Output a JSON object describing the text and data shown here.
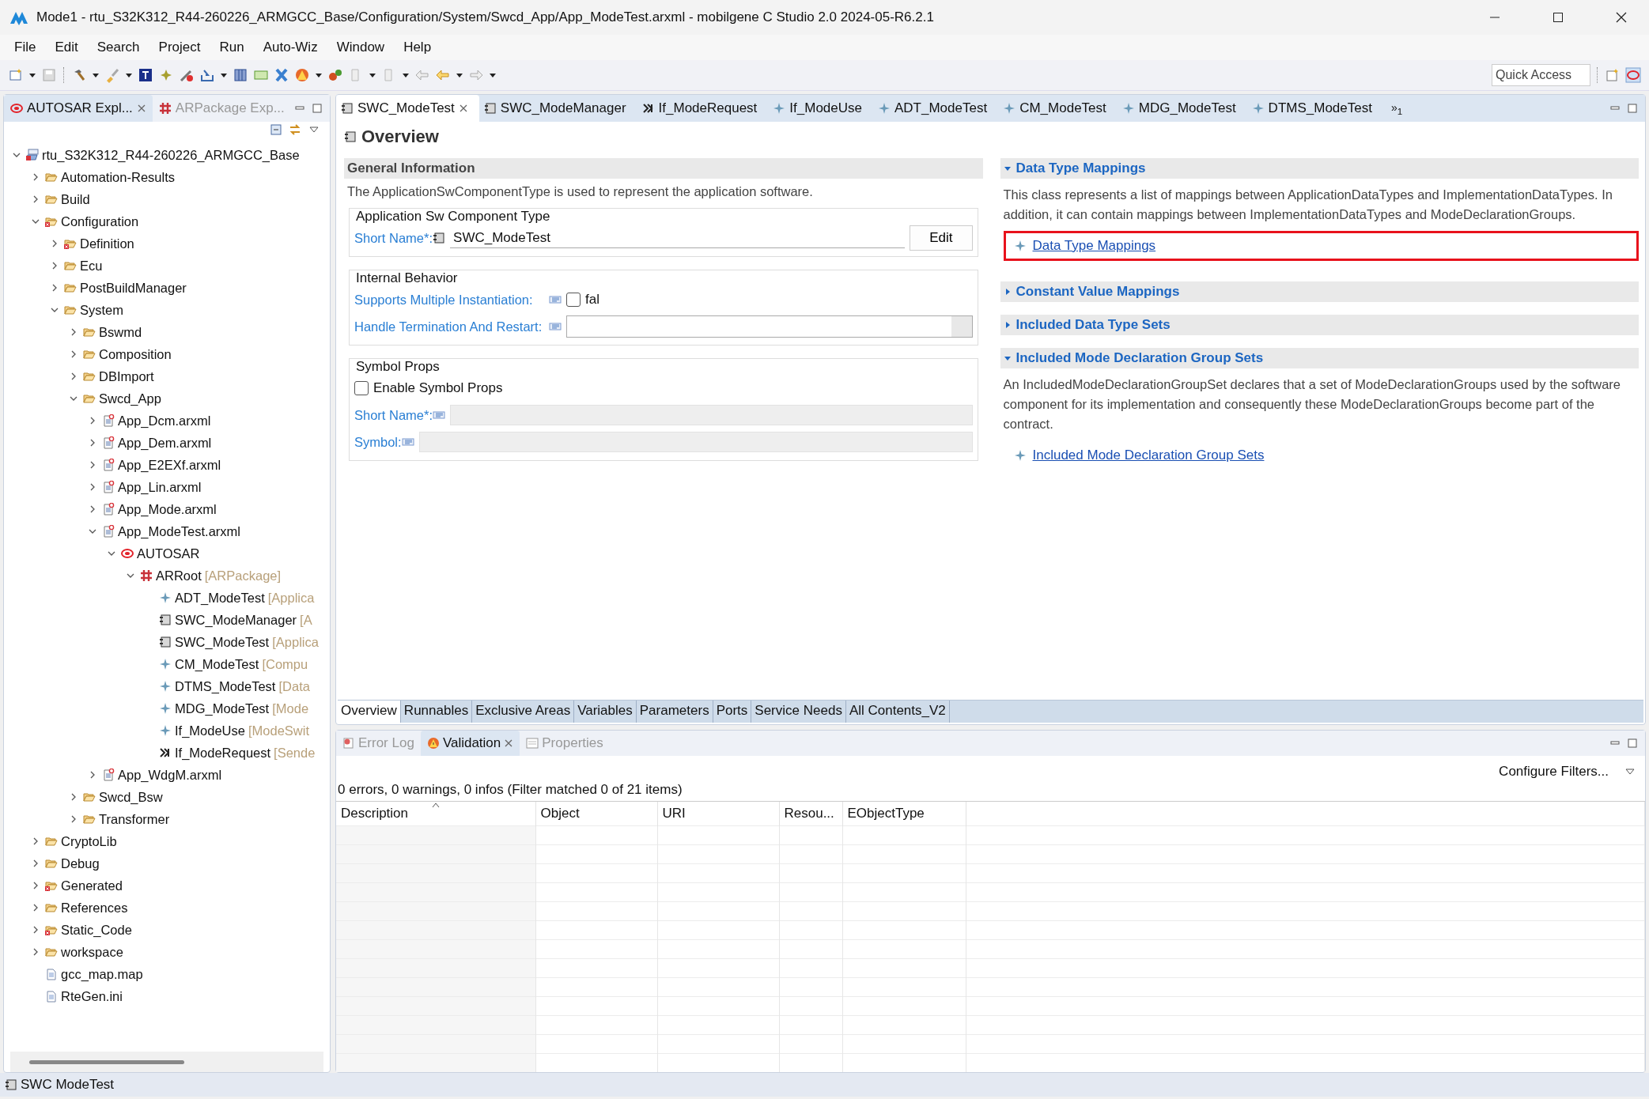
{
  "window": {
    "title": "Mode1 - rtu_S32K312_R44-260226_ARMGCC_Base/Configuration/System/Swcd_App/App_ModeTest.arxml - mobilgene C Studio 2.0 2024-05-R6.2.1"
  },
  "menu": [
    "File",
    "Edit",
    "Search",
    "Project",
    "Run",
    "Auto-Wiz",
    "Window",
    "Help"
  ],
  "toolbar": {
    "quick_access": {
      "placeholder": "Quick Access"
    }
  },
  "explorer": {
    "tabs": [
      {
        "label": "AUTOSAR Expl...",
        "selected": true,
        "kind": "autosar"
      },
      {
        "label": "ARPackage Exp...",
        "selected": false,
        "kind": "package"
      }
    ],
    "tree": [
      {
        "label": "rtu_S32K312_R44-260226_ARMGCC_Base",
        "kind": "project",
        "expanded": true,
        "children": [
          {
            "label": "Automation-Results",
            "kind": "folder",
            "expanded": false
          },
          {
            "label": "Build",
            "kind": "folder",
            "expanded": false
          },
          {
            "label": "Configuration",
            "kind": "folder-error",
            "expanded": true,
            "children": [
              {
                "label": "Definition",
                "kind": "folder-error",
                "expanded": false
              },
              {
                "label": "Ecu",
                "kind": "folder",
                "expanded": false
              },
              {
                "label": "PostBuildManager",
                "kind": "folder",
                "expanded": false
              },
              {
                "label": "System",
                "kind": "folder",
                "expanded": true,
                "children": [
                  {
                    "label": "Bswmd",
                    "kind": "folder",
                    "expanded": false
                  },
                  {
                    "label": "Composition",
                    "kind": "folder",
                    "expanded": false
                  },
                  {
                    "label": "DBImport",
                    "kind": "folder",
                    "expanded": false
                  },
                  {
                    "label": "Swcd_App",
                    "kind": "folder",
                    "expanded": true,
                    "children": [
                      {
                        "label": "App_Dcm.arxml",
                        "kind": "arxml",
                        "expanded": false
                      },
                      {
                        "label": "App_Dem.arxml",
                        "kind": "arxml",
                        "expanded": false
                      },
                      {
                        "label": "App_E2EXf.arxml",
                        "kind": "arxml",
                        "expanded": false
                      },
                      {
                        "label": "App_Lin.arxml",
                        "kind": "arxml",
                        "expanded": false
                      },
                      {
                        "label": "App_Mode.arxml",
                        "kind": "arxml",
                        "expanded": false
                      },
                      {
                        "label": "App_ModeTest.arxml",
                        "kind": "arxml",
                        "expanded": true,
                        "children": [
                          {
                            "label": "AUTOSAR",
                            "kind": "autosar",
                            "expanded": true,
                            "children": [
                              {
                                "label": "ARRoot",
                                "suffix": "[ARPackage]",
                                "kind": "package",
                                "expanded": true,
                                "children": [
                                  {
                                    "label": "ADT_ModeTest",
                                    "suffix": "[Applica",
                                    "kind": "star"
                                  },
                                  {
                                    "label": "SWC_ModeManager",
                                    "suffix": "[A",
                                    "kind": "swc"
                                  },
                                  {
                                    "label": "SWC_ModeTest",
                                    "suffix": "[Applica",
                                    "kind": "swc"
                                  },
                                  {
                                    "label": "CM_ModeTest",
                                    "suffix": "[Compu",
                                    "kind": "star"
                                  },
                                  {
                                    "label": "DTMS_ModeTest",
                                    "suffix": "[Data",
                                    "kind": "star"
                                  },
                                  {
                                    "label": "MDG_ModeTest",
                                    "suffix": "[Mode",
                                    "kind": "star"
                                  },
                                  {
                                    "label": "If_ModeUse",
                                    "suffix": "[ModeSwit",
                                    "kind": "star"
                                  },
                                  {
                                    "label": "If_ModeRequest",
                                    "suffix": "[Sende",
                                    "kind": "sender"
                                  }
                                ]
                              }
                            ]
                          }
                        ]
                      },
                      {
                        "label": "App_WdgM.arxml",
                        "kind": "arxml",
                        "expanded": false
                      }
                    ]
                  },
                  {
                    "label": "Swcd_Bsw",
                    "kind": "folder",
                    "expanded": false
                  },
                  {
                    "label": "Transformer",
                    "kind": "folder",
                    "expanded": false
                  }
                ]
              }
            ]
          },
          {
            "label": "CryptoLib",
            "kind": "folder",
            "expanded": false
          },
          {
            "label": "Debug",
            "kind": "folder",
            "expanded": false
          },
          {
            "label": "Generated",
            "kind": "folder-error",
            "expanded": false
          },
          {
            "label": "References",
            "kind": "folder",
            "expanded": false
          },
          {
            "label": "Static_Code",
            "kind": "folder-error",
            "expanded": false
          },
          {
            "label": "workspace",
            "kind": "folder",
            "expanded": false
          },
          {
            "label": "gcc_map.map",
            "kind": "file"
          },
          {
            "label": "RteGen.ini",
            "kind": "file"
          }
        ]
      }
    ]
  },
  "editor": {
    "tabs": [
      {
        "label": "SWC_ModeTest",
        "kind": "swc",
        "selected": true
      },
      {
        "label": "SWC_ModeManager",
        "kind": "swc",
        "selected": false
      },
      {
        "label": "If_ModeRequest",
        "kind": "sender",
        "selected": false
      },
      {
        "label": "If_ModeUse",
        "kind": "star",
        "selected": false
      },
      {
        "label": "ADT_ModeTest",
        "kind": "star",
        "selected": false
      },
      {
        "label": "CM_ModeTest",
        "kind": "star",
        "selected": false
      },
      {
        "label": "MDG_ModeTest",
        "kind": "star",
        "selected": false
      },
      {
        "label": "DTMS_ModeTest",
        "kind": "star",
        "selected": false
      }
    ],
    "overflow": "»$_{1}$",
    "title": "Overview",
    "general": {
      "heading": "General Information",
      "description": "The ApplicationSwComponentType is used to represent the application software.",
      "groups": [
        {
          "title": "Application Sw Component Type",
          "fields": [
            {
              "kind": "text",
              "label": "Short Name*:",
              "value": "SWC_ModeTest",
              "button": "Edit"
            }
          ]
        },
        {
          "title": "Internal Behavior",
          "fields": [
            {
              "kind": "checkbox",
              "label": "Supports Multiple Instantiation:",
              "checked": false,
              "value": "fal"
            },
            {
              "kind": "combo",
              "label": "Handle Termination And Restart:"
            }
          ]
        },
        {
          "title": "Symbol Props",
          "enable": {
            "label": "Enable Symbol Props",
            "checked": false
          },
          "fields": [
            {
              "kind": "text",
              "label": "Short Name*:",
              "disabled": true
            },
            {
              "kind": "text",
              "label": "Symbol:",
              "disabled": true
            }
          ]
        }
      ]
    },
    "sections": [
      {
        "title": "Data Type Mappings",
        "expanded": true,
        "description": "This class represents a list of mappings between ApplicationDataTypes and ImplementationDataTypes. In addition, it can contain mappings between ImplementationDataTypes and ModeDeclarationGroups.",
        "link": {
          "label": "Data Type Mappings",
          "highlighted": true
        }
      },
      {
        "title": "Constant Value Mappings",
        "expanded": false
      },
      {
        "title": "Included Data Type Sets",
        "expanded": false
      },
      {
        "title": "Included Mode Declaration Group Sets",
        "expanded": true,
        "description": "An IncludedModeDeclarationGroupSet declares that a set of ModeDeclarationGroups used by the software component for its implementation and consequently these ModeDeclarationGroups become part of the contract.",
        "link": {
          "label": "Included Mode Declaration Group Sets",
          "highlighted": false
        }
      }
    ],
    "page_tabs": [
      {
        "label": "Overview",
        "selected": true
      },
      {
        "label": "Runnables",
        "selected": false
      },
      {
        "label": "Exclusive Areas",
        "selected": false
      },
      {
        "label": "Variables",
        "selected": false
      },
      {
        "label": "Parameters",
        "selected": false
      },
      {
        "label": "Ports",
        "selected": false
      },
      {
        "label": "Service Needs",
        "selected": false
      },
      {
        "label": "All Contents_V2",
        "selected": false
      }
    ]
  },
  "bottom_panel": {
    "tabs": [
      {
        "label": "Error Log",
        "kind": "error-log",
        "selected": false
      },
      {
        "label": "Validation",
        "kind": "validation",
        "selected": true
      },
      {
        "label": "Properties",
        "kind": "properties",
        "selected": false
      }
    ],
    "configure_filters": "Configure Filters...",
    "summary": "0 errors, 0 warnings, 0 infos (Filter matched 0 of 21 items)",
    "columns": [
      {
        "label": "Description",
        "sorted": true
      },
      {
        "label": "Object",
        "sorted": false
      },
      {
        "label": "URI",
        "sorted": false
      },
      {
        "label": "Resou...",
        "sorted": false
      },
      {
        "label": "EObjectType",
        "sorted": false
      }
    ]
  },
  "status_bar": {
    "text": "SWC ModeTest",
    "kind": "swc"
  }
}
